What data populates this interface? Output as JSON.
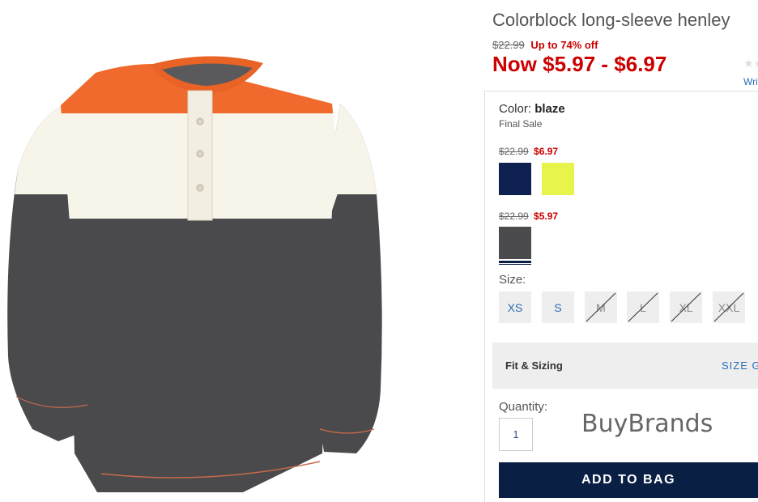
{
  "product": {
    "title": "Colorblock long-sleeve henley",
    "original_price": "$22.99",
    "discount_text": "Up to 74% off",
    "now_price": "Now $5.97 - $6.97",
    "rating_stars": "★★",
    "write_review": "Write a review"
  },
  "color": {
    "label_prefix": "Color:",
    "selected": "blaze",
    "final_sale": "Final Sale"
  },
  "price_groups": [
    {
      "original": "$22.99",
      "sale": "$6.97",
      "swatches": [
        {
          "name": "navy",
          "color": "#0f2150"
        },
        {
          "name": "neon yellow",
          "color": "#e7f44a"
        }
      ]
    },
    {
      "original": "$22.99",
      "sale": "$5.97",
      "swatches": [
        {
          "name": "blaze",
          "color": "#4b4b4d",
          "selected": true
        }
      ]
    }
  ],
  "size": {
    "label": "Size:",
    "options": [
      {
        "label": "XS",
        "available": true
      },
      {
        "label": "S",
        "available": true
      },
      {
        "label": "M",
        "available": false
      },
      {
        "label": "L",
        "available": false
      },
      {
        "label": "XL",
        "available": false
      },
      {
        "label": "XXL",
        "available": false
      }
    ]
  },
  "fit": {
    "label": "Fit & Sizing",
    "size_guide": "SIZE GUIDE"
  },
  "quantity": {
    "label": "Quantity:",
    "value": "1"
  },
  "watermark": "BuyBrands",
  "add_to_bag": "ADD TO BAG",
  "colors": {
    "sale_red": "#cc0000",
    "link_blue": "#2a6eb5",
    "button_navy": "#0a1f44",
    "shirt_orange": "#ef6a2c",
    "shirt_cream": "#f7f4ea",
    "shirt_gray": "#4a4a4c"
  }
}
